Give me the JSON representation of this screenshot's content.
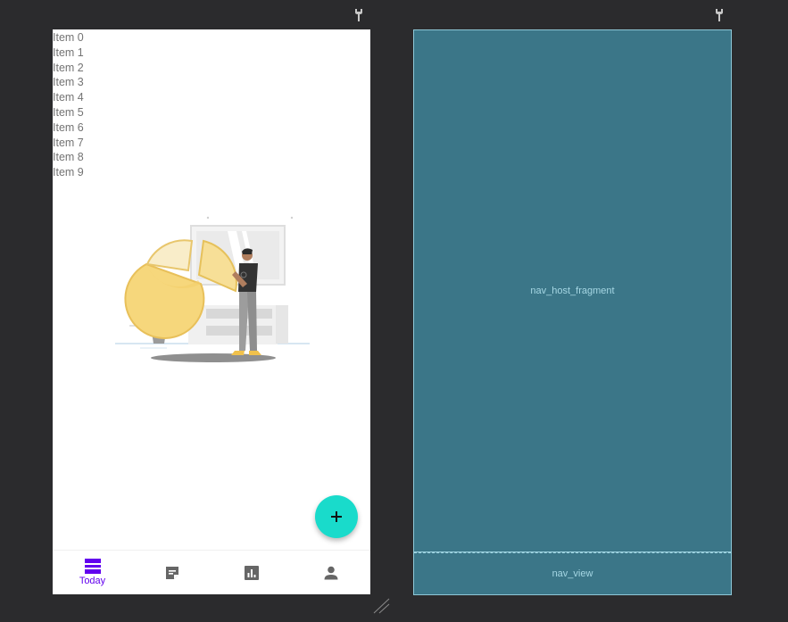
{
  "icons": {
    "design_wrench": "wrench-icon",
    "blueprint_wrench": "wrench-icon",
    "fab": "add-icon",
    "resize": "resize-handle-icon"
  },
  "design": {
    "list_items": [
      "Item 0",
      "Item 1",
      "Item 2",
      "Item 3",
      "Item 4",
      "Item 5",
      "Item 6",
      "Item 7",
      "Item 8",
      "Item 9"
    ],
    "bottom_nav": {
      "items": [
        {
          "label": "Today",
          "icon": "today-icon",
          "selected": true
        },
        {
          "label": "",
          "icon": "note-icon",
          "selected": false
        },
        {
          "label": "",
          "icon": "chart-icon",
          "selected": false
        },
        {
          "label": "",
          "icon": "person-icon",
          "selected": false
        }
      ]
    }
  },
  "blueprint": {
    "host_label": "nav_host_fragment",
    "nav_label": "nav_view"
  },
  "colors": {
    "canvas_bg": "#2b2b2d",
    "accent_purple": "#6200ee",
    "fab_teal": "#19dbcb",
    "blueprint_bg": "#3b7688",
    "blueprint_line": "#9ad0de",
    "nav_icon_gray": "#666666"
  }
}
